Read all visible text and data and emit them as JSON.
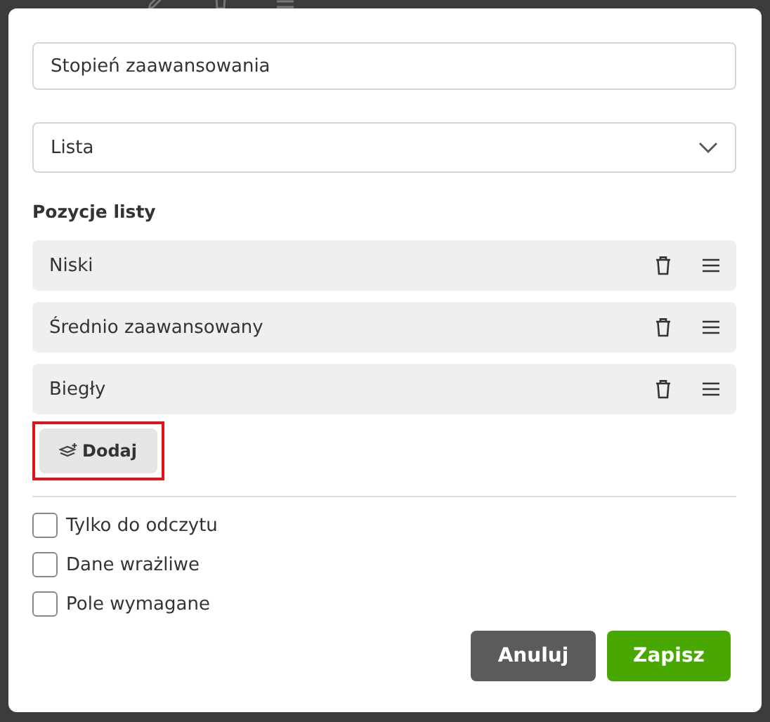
{
  "name_field": {
    "value": "Stopień zaawansowania"
  },
  "type_select": {
    "value": "Lista"
  },
  "list_section": {
    "heading": "Pozycje listy",
    "items": [
      {
        "label": "Niski"
      },
      {
        "label": "Średnio zaawansowany"
      },
      {
        "label": "Biegły"
      }
    ],
    "add_button": {
      "label": "Dodaj",
      "highlighted": true
    }
  },
  "options": [
    {
      "label": "Tylko do odczytu",
      "checked": false
    },
    {
      "label": "Dane wrażliwe",
      "checked": false
    },
    {
      "label": "Pole wymagane",
      "checked": false
    }
  ],
  "buttons": [
    {
      "label": "Anuluj",
      "kind": "cancel"
    },
    {
      "label": "Zapisz",
      "kind": "primary"
    }
  ]
}
